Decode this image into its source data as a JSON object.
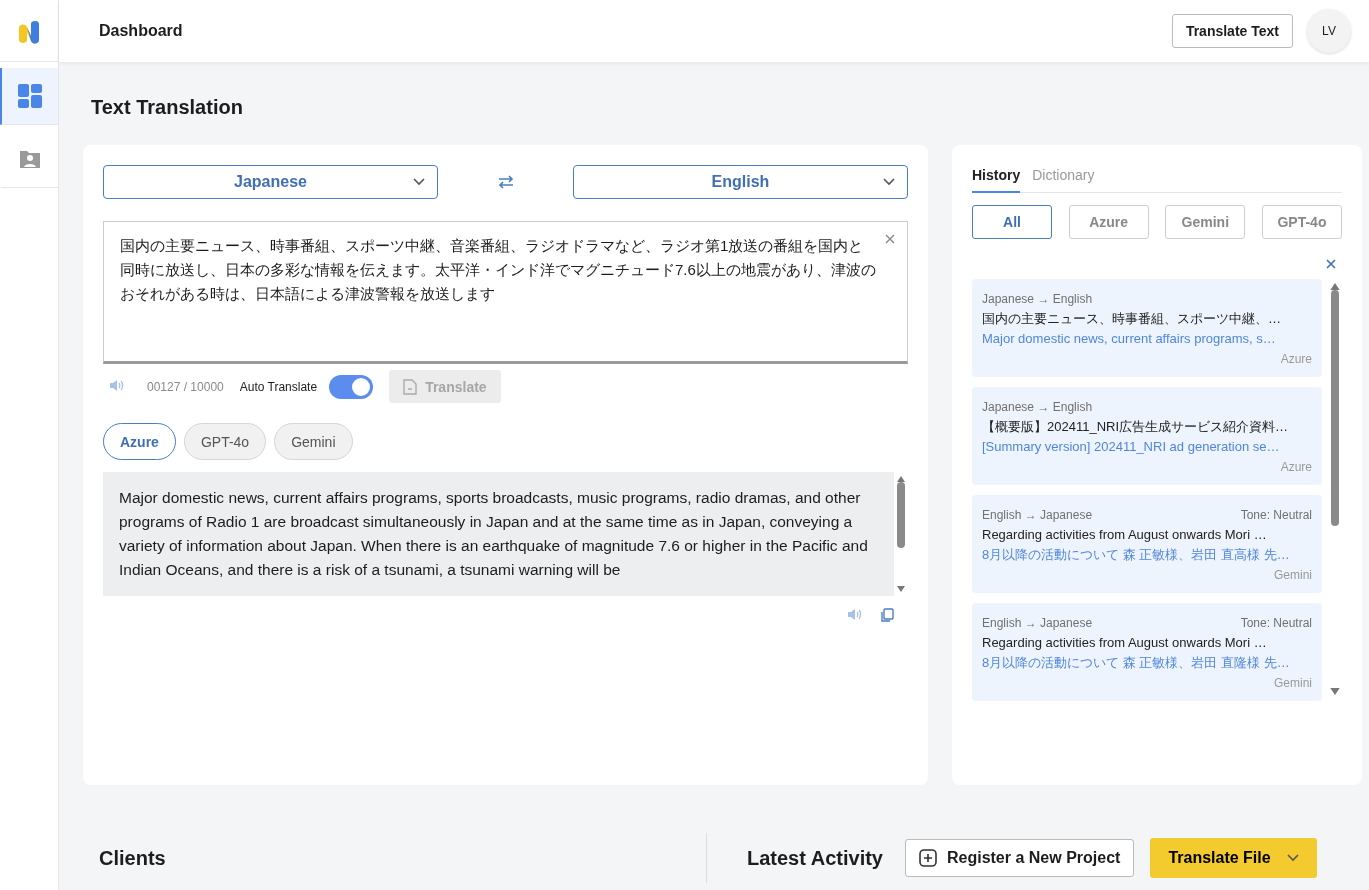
{
  "header": {
    "title": "Dashboard",
    "action_button": "Translate Text",
    "avatar": "LV"
  },
  "sidebar": {
    "items": [
      {
        "kind": "dashboard",
        "selected": true
      },
      {
        "kind": "clients",
        "selected": false
      }
    ]
  },
  "page_title": "Text Translation",
  "translator": {
    "source_language": "Japanese",
    "target_language": "English",
    "input_text": "国内の主要ニュース、時事番組、スポーツ中継、音楽番組、ラジオドラマなど、ラジオ第1放送の番組を国内と同時に放送し、日本の多彩な情報を伝えます。太平洋・インド洋でマグニチュード7.6以上の地震があり、津波のおそれがある時は、日本語による津波警報を放送します",
    "char_count": "00127 / 10000",
    "auto_translate": {
      "label": "Auto Translate",
      "on": true
    },
    "translate_button": {
      "label": "Translate",
      "disabled": true
    },
    "engines": [
      {
        "label": "Azure",
        "selected": true
      },
      {
        "label": "GPT-4o",
        "selected": false
      },
      {
        "label": "Gemini",
        "selected": false
      }
    ],
    "output_text": "Major domestic news, current affairs programs, sports broadcasts, music programs, radio dramas, and other programs of Radio 1 are broadcast simultaneously in Japan and at the same time as in Japan, conveying a variety of information about Japan. When there is an earthquake of magnitude 7.6 or higher in the Pacific and Indian Oceans, and there is a risk of a tsunami, a tsunami warning will be"
  },
  "history_panel": {
    "tabs": [
      {
        "label": "History",
        "selected": true
      },
      {
        "label": "Dictionary",
        "selected": false
      }
    ],
    "filters": [
      {
        "label": "All",
        "selected": true
      },
      {
        "label": "Azure",
        "selected": false
      },
      {
        "label": "Gemini",
        "selected": false
      },
      {
        "label": "GPT-4o",
        "selected": false
      }
    ],
    "items": [
      {
        "direction": "Japanese → English",
        "source": "国内の主要ニュース、時事番組、スポーツ中継、…",
        "target": "Major domestic news, current affairs programs, s…",
        "engine": "Azure"
      },
      {
        "direction": "Japanese → English",
        "source": "【概要版】202411_NRI広告生成サービス紹介資料…",
        "target": "[Summary version] 202411_NRI ad generation se…",
        "engine": "Azure"
      },
      {
        "direction": "English → Japanese",
        "tone": "Tone: Neutral",
        "source": "Regarding activities from August onwards Mori …",
        "target": "8月以降の活動について 森 正敏様、岩田 直高様 先…",
        "engine": "Gemini"
      },
      {
        "direction": "English → Japanese",
        "tone": "Tone: Neutral",
        "source": "Regarding activities from August onwards Mori …",
        "target": "8月以降の活動について 森 正敏様、岩田 直隆様 先…",
        "engine": "Gemini"
      }
    ]
  },
  "bottom": {
    "clients_title": "Clients",
    "activity_title": "Latest Activity",
    "register_button": "Register a New Project",
    "translate_file_button": "Translate File"
  }
}
